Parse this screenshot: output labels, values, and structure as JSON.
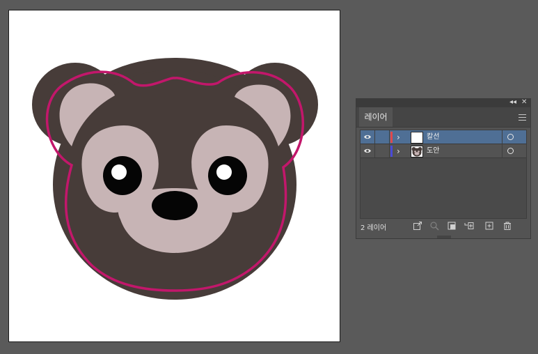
{
  "panel": {
    "tab_label": "레이어",
    "layer_count": "2 레이어",
    "layers": [
      {
        "name": "칼선",
        "color": "#e0484b",
        "selected": true
      },
      {
        "name": "도안",
        "color": "#4a4ad8",
        "selected": false
      }
    ],
    "footer_icons": [
      "export-icon",
      "locate-object-icon",
      "clipping-mask-icon",
      "new-sublayer-icon",
      "new-layer-icon",
      "trash-icon"
    ],
    "selected_row_color": "#4f6f95"
  },
  "artwork": {
    "description_colors": {
      "bear_dark": "#473c39",
      "bear_light": "#c7b4b5",
      "cutline": "#c2176b",
      "eyes": "#050505"
    }
  }
}
